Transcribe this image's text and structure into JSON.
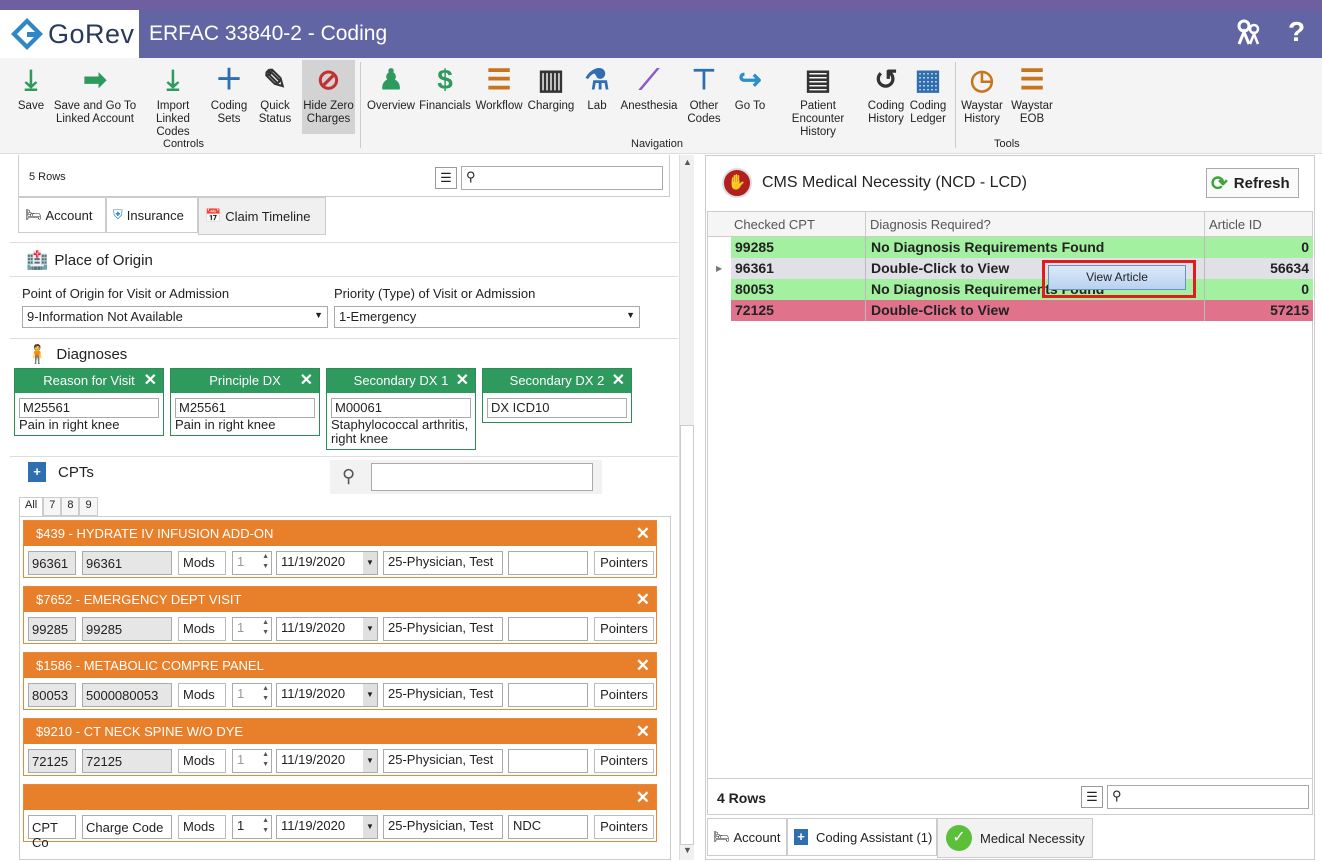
{
  "app": {
    "logo_text": "GoRev",
    "window_title": "ERFAC 33840-2 - Coding"
  },
  "ribbon": {
    "controls": [
      {
        "label": "Save",
        "icon": "save-download-icon"
      },
      {
        "label": "Save and Go To\nLinked Account",
        "icon": "arrow-right-icon"
      },
      {
        "label": "Import\nLinked Codes",
        "icon": "import-download-icon"
      },
      {
        "label": "Coding\nSets",
        "icon": "book-plus-icon"
      },
      {
        "label": "Quick\nStatus",
        "icon": "doc-pen-icon"
      },
      {
        "label": "Hide Zero\nCharges",
        "icon": "eye-slash-icon"
      }
    ],
    "controls_label": "Controls",
    "navigation": [
      {
        "label": "Overview",
        "icon": "person-icon"
      },
      {
        "label": "Financials",
        "icon": "dollar-icon"
      },
      {
        "label": "Workflow",
        "icon": "list-icon"
      },
      {
        "label": "Charging",
        "icon": "barcode-icon"
      },
      {
        "label": "Lab",
        "icon": "test-tubes-icon"
      },
      {
        "label": "Anesthesia",
        "icon": "syringe-icon"
      },
      {
        "label": "Other\nCodes",
        "icon": "tree-icon"
      },
      {
        "label": "Go To",
        "icon": "share-arrow-icon"
      },
      {
        "label": "Patient Encounter\nHistory",
        "icon": "doc-list-icon"
      },
      {
        "label": "Coding\nHistory",
        "icon": "history-icon"
      },
      {
        "label": "Coding\nLedger",
        "icon": "calculator-icon"
      }
    ],
    "navigation_label": "Navigation",
    "tools": [
      {
        "label": "Waystar\nHistory",
        "icon": "clock-icon"
      },
      {
        "label": "Waystar\nEOB",
        "icon": "list-icon"
      }
    ],
    "tools_label": "Tools"
  },
  "left": {
    "rows_count": "5 Rows",
    "tabs": [
      "Account",
      "Insurance",
      "Claim Timeline"
    ],
    "place_of_origin": {
      "title": "Place of Origin",
      "point_label": "Point of Origin for Visit or Admission",
      "point_value": "9-Information Not Available",
      "priority_label": "Priority (Type) of Visit or Admission",
      "priority_value": "1-Emergency"
    },
    "diagnoses": {
      "title": "Diagnoses",
      "cards": [
        {
          "head": "Reason for Visit",
          "code": "M25561",
          "desc": "Pain in right knee"
        },
        {
          "head": "Principle DX",
          "code": "M25561",
          "desc": "Pain in right knee"
        },
        {
          "head": "Secondary DX 1",
          "code": "M00061",
          "desc": "Staphylococcal arthritis, right knee"
        },
        {
          "head": "Secondary DX 2",
          "code": "DX ICD10",
          "desc": ""
        }
      ]
    },
    "cpts": {
      "title": "CPTs",
      "filter_tabs": [
        "All",
        "7",
        "8",
        "9"
      ],
      "items": [
        {
          "head": "$439 - HYDRATE IV INFUSION ADD-ON",
          "cpt": "96361",
          "charge": "96361",
          "units": "1",
          "date": "11/19/2020",
          "physician": "25-Physician, Test",
          "ndc": ""
        },
        {
          "head": "$7652 - EMERGENCY DEPT VISIT",
          "cpt": "99285",
          "charge": "99285",
          "units": "1",
          "date": "11/19/2020",
          "physician": "25-Physician, Test",
          "ndc": ""
        },
        {
          "head": "$1586 - METABOLIC COMPRE PANEL",
          "cpt": "80053",
          "charge": "5000080053",
          "units": "1",
          "date": "11/19/2020",
          "physician": "25-Physician, Test",
          "ndc": ""
        },
        {
          "head": "$9210 - CT NECK SPINE W/O DYE",
          "cpt": "72125",
          "charge": "72125",
          "units": "1",
          "date": "11/19/2020",
          "physician": "25-Physician, Test",
          "ndc": ""
        },
        {
          "head": "",
          "cpt": "CPT Co",
          "charge": "Charge Code",
          "units": "1",
          "date": "11/19/2020",
          "physician": "25-Physician, Test",
          "ndc": "NDC"
        }
      ],
      "mods_label": "Mods",
      "pointers_label": "Pointers"
    }
  },
  "right": {
    "title": "CMS Medical Necessity (NCD - LCD)",
    "refresh_label": "Refresh",
    "columns": [
      "Checked CPT",
      "Diagnosis Required?",
      "Article ID"
    ],
    "rows": [
      {
        "cpt": "99285",
        "diag": "No Diagnosis Requirements Found",
        "article": "0",
        "color": "#a3f0a0"
      },
      {
        "cpt": "96361",
        "diag": "Double-Click to View",
        "article": "56634",
        "color": "#e0e0e6"
      },
      {
        "cpt": "80053",
        "diag": "No Diagnosis Requirements Found",
        "article": "0",
        "color": "#a3f0a0"
      },
      {
        "cpt": "72125",
        "diag": "Double-Click to View",
        "article": "57215",
        "color": "#e0728c"
      }
    ],
    "context_menu": "View Article",
    "rows_count": "4 Rows",
    "bottom_tabs": [
      "Account",
      "Coding Assistant (1)",
      "Medical Necessity"
    ]
  }
}
